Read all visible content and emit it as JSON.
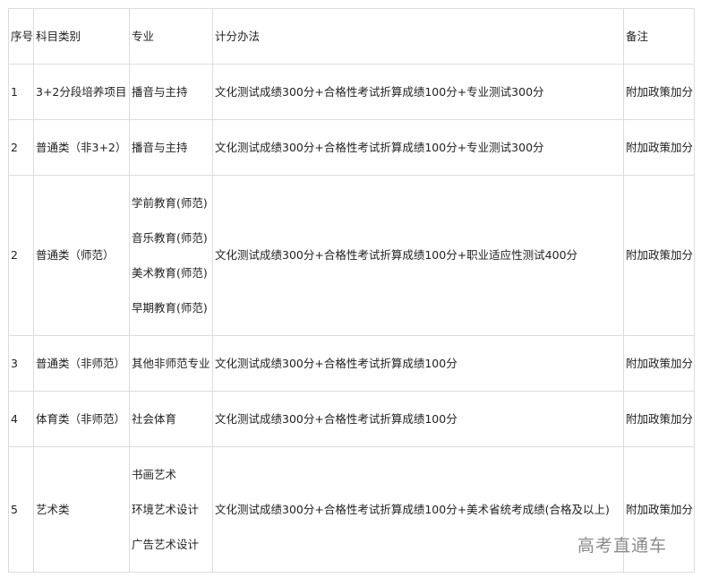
{
  "table": {
    "headers": [
      "序号",
      "科目类别",
      "专业",
      "计分办法",
      "备注"
    ],
    "rows": [
      {
        "no": "1",
        "category": "3+2分段培养项目",
        "majors": [
          "播音与主持"
        ],
        "method": "文化测试成绩300分+合格性考试折算成绩100分+专业测试300分",
        "note": "附加政策加分"
      },
      {
        "no": "2",
        "category": "普通类（非3+2）",
        "majors": [
          "播音与主持"
        ],
        "method": "文化测试成绩300分+合格性考试折算成绩100分+专业测试300分",
        "note": "附加政策加分"
      },
      {
        "no": "2",
        "category": "普通类（师范）",
        "majors": [
          "学前教育(师范)",
          "音乐教育(师范)",
          "美术教育(师范)",
          "早期教育(师范)"
        ],
        "method": "文化测试成绩300分+合格性考试折算成绩100分+职业适应性测试400分",
        "note": "附加政策加分"
      },
      {
        "no": "3",
        "category": "普通类（非师范）",
        "majors": [
          "其他非师范专业"
        ],
        "method": "文化测试成绩300分+合格性考试折算成绩100分",
        "note": "附加政策加分"
      },
      {
        "no": "4",
        "category": "体育类（非师范）",
        "majors": [
          "社会体育"
        ],
        "method": "文化测试成绩300分+合格性考试折算成绩100分",
        "note": "附加政策加分"
      },
      {
        "no": "5",
        "category": "艺术类",
        "majors": [
          "书画艺术",
          "环境艺术设计",
          "广告艺术设计"
        ],
        "method": "文化测试成绩300分+合格性考试折算成绩100分+美术省统考成绩(合格及以上)",
        "note": "附加政策加分"
      }
    ]
  },
  "watermark": "高考直通车"
}
